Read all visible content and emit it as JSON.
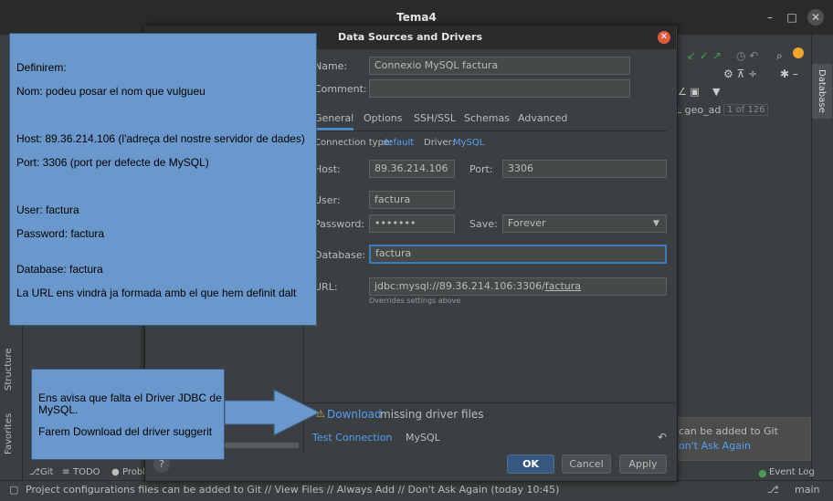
{
  "window": {
    "title": "Tema4",
    "minimize": "–",
    "maximize": "□",
    "close": "✕"
  },
  "left_strip": {
    "structure_label": "Structure",
    "favorites_label": "Favorites"
  },
  "bottom_tabs": {
    "git": "Git",
    "todo": "TODO",
    "problems": "Proble"
  },
  "right_panel": {
    "db_tab": "Database",
    "schema_label": "L geo_ad",
    "count_badge": "1 of 126",
    "notification_text": "can be added to Git",
    "notification_link": "on't Ask Again",
    "event_log": "Event Log",
    "branch": "main"
  },
  "status": {
    "message": "Project configurations files can be added to Git // View Files // Always Add // Don't Ask Again (today 10:45)"
  },
  "dialog": {
    "title": "Data Sources and Drivers",
    "name_label": "Name:",
    "name_value": "Connexio MySQL factura",
    "comment_label": "Comment:",
    "tabs": [
      "General",
      "Options",
      "SSH/SSL",
      "Schemas",
      "Advanced"
    ],
    "conn_type_label": "Connection type:",
    "conn_type_value": "default",
    "driver_label": "Driver:",
    "driver_value": "MySQL",
    "host_label": "Host:",
    "host_value": "89.36.214.106",
    "port_label": "Port:",
    "port_value": "3306",
    "user_label": "User:",
    "user_value": "factura",
    "password_label": "Password:",
    "password_value": "•••••••",
    "save_label": "Save:",
    "save_value": "Forever",
    "database_label": "Database:",
    "database_value": "factura",
    "url_label": "URL:",
    "url_prefix": "jdbc:mysql://89.36.214.106:3306/",
    "url_db": "factura",
    "url_note": "Overrides settings above",
    "download_link": "Download",
    "download_text": "missing driver files",
    "test_connection": "Test Connection",
    "mysql_label": "MySQL",
    "help": "?",
    "ok": "OK",
    "cancel": "Cancel",
    "apply": "Apply"
  },
  "notes": {
    "big": [
      "Definirem:",
      "Nom: podeu posar el nom que vulgueu",
      "Host: 89.36.214.106 (l'adreça del nostre servidor de dades)",
      "Port: 3306 (port per defecte de MySQL)",
      "User: factura",
      "Password: factura",
      "Database: factura",
      "La URL ens vindrà ja formada amb el que hem definit dalt"
    ],
    "small": [
      "Ens avisa que falta el Driver JDBC de",
      "MySQL.",
      "Farem Download del driver suggerit"
    ]
  },
  "colors": {
    "accent": "#589df6",
    "note_bg": "#6a98cc",
    "close_btn": "#e05a3c",
    "ok_btn": "#365880"
  }
}
